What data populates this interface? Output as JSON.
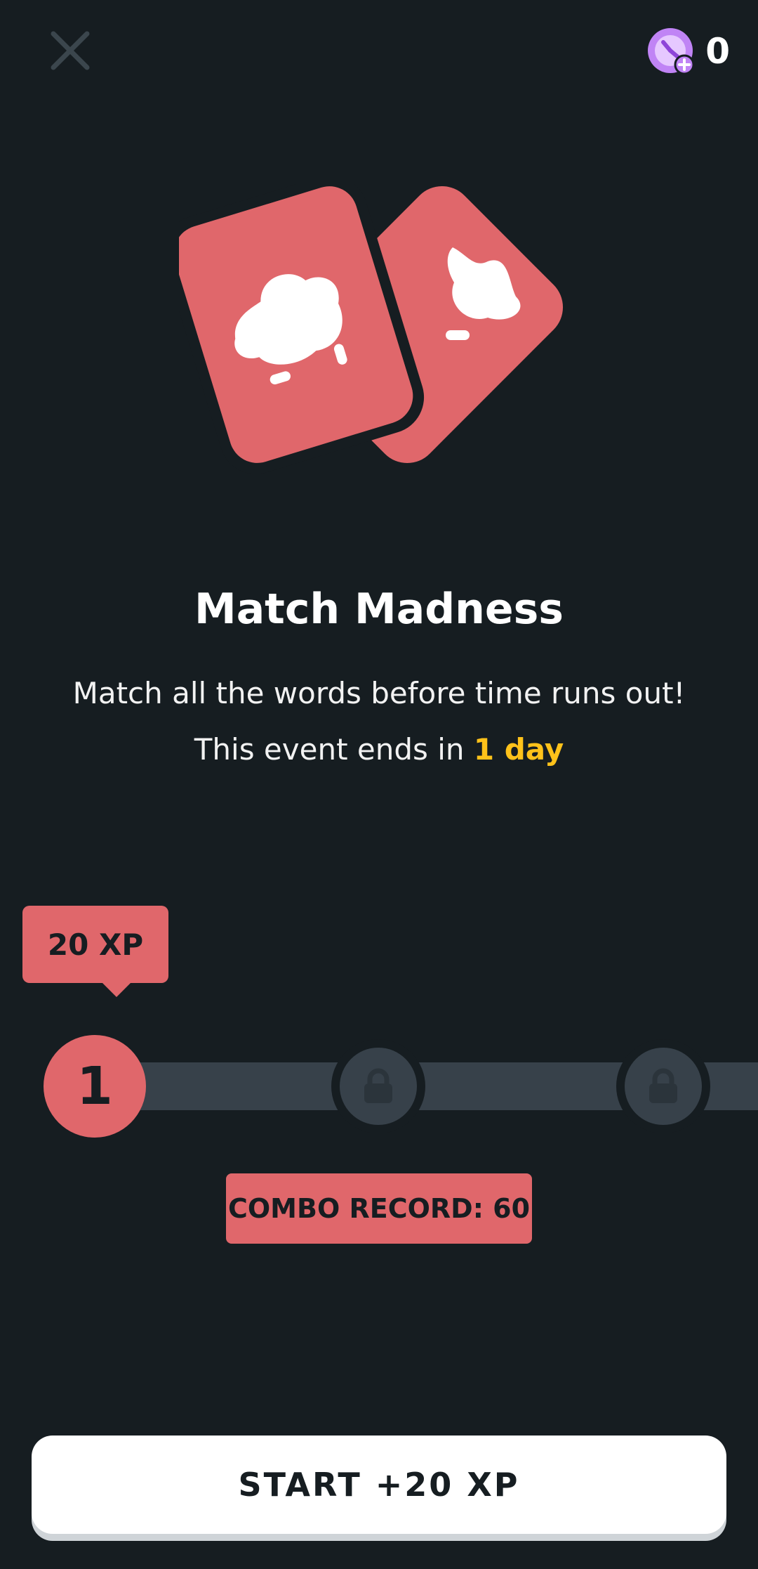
{
  "header": {
    "close_icon": "close-icon",
    "timer_icon": "timer-boost-icon",
    "timer_count": "0"
  },
  "colors": {
    "background": "#161d21",
    "accent": "#e0676b",
    "highlight": "#ffc21a",
    "track": "#37414a"
  },
  "main": {
    "title": "Match Madness",
    "subtitle": "Match all the words before time runs out!",
    "ends_prefix": "This event ends in ",
    "ends_value": "1 day"
  },
  "progress": {
    "reward_label": "20 XP",
    "current_step": "1",
    "steps": [
      {
        "state": "active",
        "label": "1"
      },
      {
        "state": "locked",
        "icon": "lock-icon"
      },
      {
        "state": "locked",
        "icon": "lock-icon"
      }
    ]
  },
  "combo_record": "COMBO RECORD: 60",
  "start_button": "START +20 XP"
}
